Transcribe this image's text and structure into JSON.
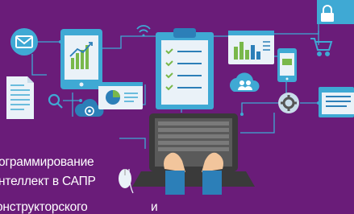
{
  "colors": {
    "background": "#6a1c79",
    "line": "#3fa9d4",
    "panel": "#c9dcea",
    "accent_green": "#79b84a",
    "accent_blue": "#2c7fb8",
    "laptop": "#3a3a3a"
  },
  "icons": [
    "envelope-icon",
    "tablet-chart-icon",
    "wifi-icon",
    "clipboard-checklist-icon",
    "bar-chart-window-icon",
    "lock-icon",
    "shopping-cart-icon",
    "smartphone-icon",
    "cloud-users-icon",
    "document-icon",
    "magnifier-icon",
    "cloud-email-icon",
    "pie-chart-window-icon",
    "gear-icon",
    "browser-window-icon",
    "laptop-icon",
    "mouse-icon",
    "hands-icon"
  ],
  "caption": {
    "line1": "ограммирование",
    "line2": "нтеллект в САПР",
    "line3": "онструкторского",
    "line4": "и"
  }
}
